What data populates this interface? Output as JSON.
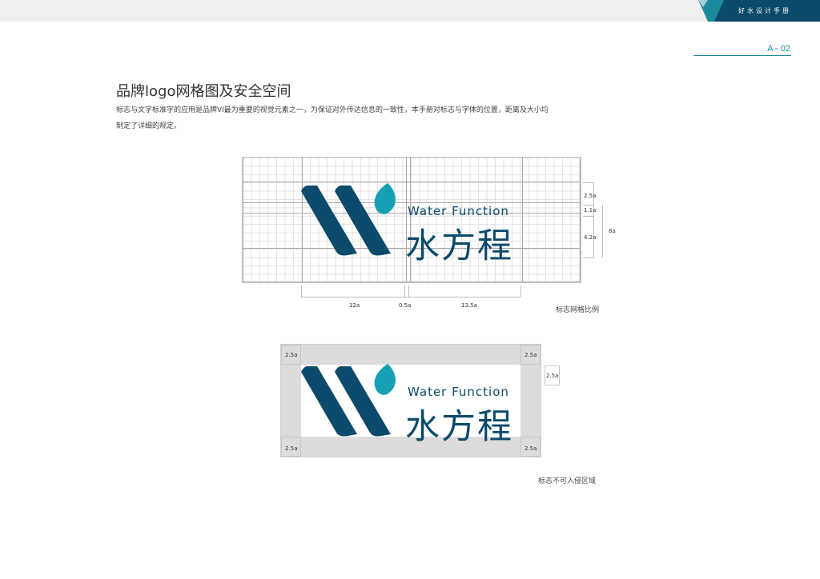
{
  "header": {
    "corner_text": "好水设计手册",
    "page_number": "A - 02",
    "accent_color": "#1a8a9e",
    "dark_color": "#0b4a6b"
  },
  "section": {
    "title": "品牌logo网格图及安全空间",
    "description": "标志与文字标准字的应用是品牌VI最为重要的视觉元素之一，为保证对外传达信息的一致性，本手册对标志与字体的位置，距离及大小均制定了详细的规定。"
  },
  "logo": {
    "english": "Water Function",
    "chinese": "水方程"
  },
  "grid_figure": {
    "right_dims": [
      "2.5a",
      "1.1a",
      "4.2a"
    ],
    "right_total": "8a",
    "bottom_dims": [
      "12a",
      "0.5a",
      "13.5a"
    ],
    "caption": "标志网格比例"
  },
  "safe_figure": {
    "corner_labels": [
      "2.5a",
      "2.5a",
      "2.5a",
      "2.5a"
    ],
    "side_label": "2.5a",
    "caption": "标志不可入侵区域"
  }
}
